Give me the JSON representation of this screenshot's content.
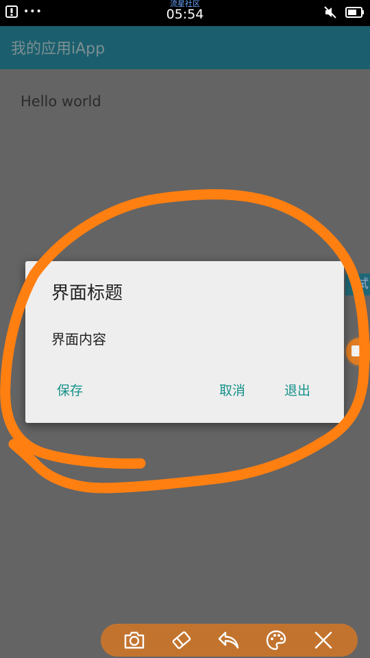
{
  "status_bar": {
    "ticker": "流星社区",
    "time": "05:54",
    "more_dots": "•••"
  },
  "app": {
    "title": "我的应用iApp"
  },
  "content": {
    "hello_text": "Hello world"
  },
  "edge_tag": {
    "label": "试"
  },
  "dialog": {
    "title": "界面标题",
    "message": "界面内容",
    "buttons": {
      "save": "保存",
      "cancel": "取消",
      "exit": "退出"
    }
  },
  "colors": {
    "status_bar": "#000000",
    "app_bar": "#1b5f6e",
    "content_bg": "#646464",
    "dialog_bg": "#eeeeee",
    "dialog_button": "#14918a",
    "annotation_stroke": "#ff7f11",
    "toolbar_bg": "#c2742f"
  },
  "toolbar": {
    "tools": [
      "camera-icon",
      "eraser-icon",
      "undo-icon",
      "palette-icon",
      "close-icon"
    ]
  }
}
